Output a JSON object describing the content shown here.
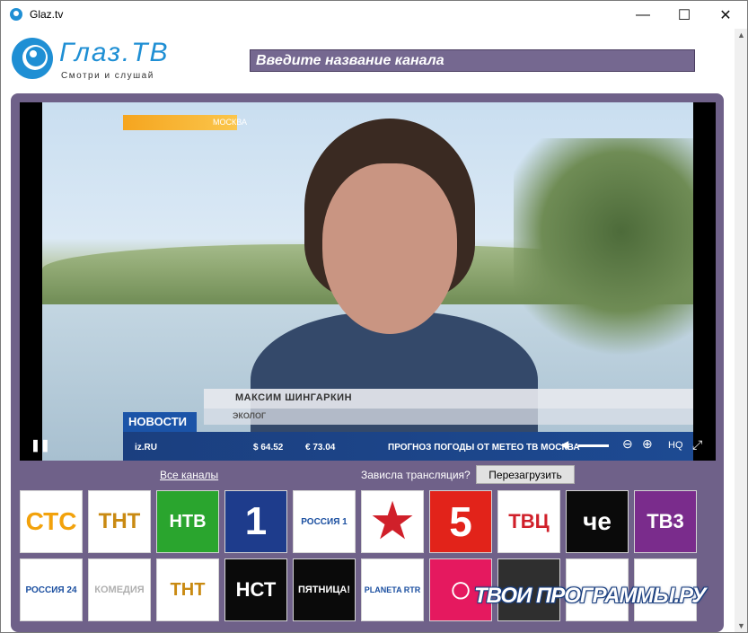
{
  "window": {
    "title": "Glaz.tv",
    "minimize_glyph": "—",
    "maximize_glyph": "☐",
    "close_glyph": "✕"
  },
  "logo": {
    "text": "Глаз.ТВ",
    "tagline": "Смотри и слушай"
  },
  "search": {
    "placeholder": "Введите название канала"
  },
  "player": {
    "location_tag": "МОСКВА",
    "person_name": "МАКСИМ ШИНГАРКИН",
    "person_role": "ЭКОЛОГ",
    "news_label": "НОВОСТИ",
    "site": "iz.RU",
    "rate_usd": "$ 64.52",
    "rate_eur": "€ 73.04",
    "ticker": "ПРОГНОЗ ПОГОДЫ ОТ МЕТЕО ТВ МОСКВА",
    "play_glyph": "❚❚",
    "volume_glyph": "◀",
    "zoom_out_glyph": "⊖",
    "zoom_in_glyph": "⊕",
    "quality": "HQ",
    "fullscreen_glyph": "⤢"
  },
  "controls": {
    "all_channels": "Все каналы",
    "freeze_question": "Зависла трансляция?",
    "reload": "Перезагрузить"
  },
  "channels": [
    {
      "label": "СТС",
      "bg": "#ffffff",
      "fg": "#f2a20c",
      "size": 28
    },
    {
      "label": "ТНТ",
      "bg": "#ffffff",
      "fg": "#c98a12",
      "size": 24
    },
    {
      "label": "НТВ",
      "bg": "#2aa52e",
      "fg": "#ffffff",
      "size": 20
    },
    {
      "label": "1",
      "bg": "#1e3c8c",
      "fg": "#ffffff",
      "size": 44
    },
    {
      "label": "РОССИЯ 1",
      "bg": "#ffffff",
      "fg": "#1b4fa0",
      "size": 10
    },
    {
      "label": "★",
      "bg": "#ffffff",
      "fg": "#d0202a",
      "size": 52
    },
    {
      "label": "5",
      "bg": "#e2231a",
      "fg": "#ffffff",
      "size": 46
    },
    {
      "label": "ТВЦ",
      "bg": "#ffffff",
      "fg": "#d0202a",
      "size": 22
    },
    {
      "label": "че",
      "bg": "#0a0a0a",
      "fg": "#ffffff",
      "size": 28
    },
    {
      "label": "ТВ3",
      "bg": "#7a2c8c",
      "fg": "#ffffff",
      "size": 22
    },
    {
      "label": "РОССИЯ 24",
      "bg": "#ffffff",
      "fg": "#1b4fa0",
      "size": 10
    },
    {
      "label": "КОМЕДИЯ",
      "bg": "#ffffff",
      "fg": "#b0b0b0",
      "size": 11
    },
    {
      "label": "ТНТ",
      "bg": "#ffffff",
      "fg": "#c98a12",
      "size": 20
    },
    {
      "label": "НСТ",
      "bg": "#0a0a0a",
      "fg": "#ffffff",
      "size": 22
    },
    {
      "label": "ПЯТНИЦА!",
      "bg": "#0a0a0a",
      "fg": "#ffffff",
      "size": 11
    },
    {
      "label": "PLANETA RTR",
      "bg": "#ffffff",
      "fg": "#1b4fa0",
      "size": 9
    },
    {
      "label": "○",
      "bg": "#e5195f",
      "fg": "#ffffff",
      "size": 44
    },
    {
      "label": "",
      "bg": "#2f2f2f",
      "fg": "#ffffff",
      "size": 22
    },
    {
      "label": "",
      "bg": "#ffffff",
      "fg": "#2a3a6a",
      "size": 22
    },
    {
      "label": "",
      "bg": "#ffffff",
      "fg": "#c8202a",
      "size": 20
    }
  ],
  "watermark": "ТВОИ ПРОГРАММЫ.РУ"
}
